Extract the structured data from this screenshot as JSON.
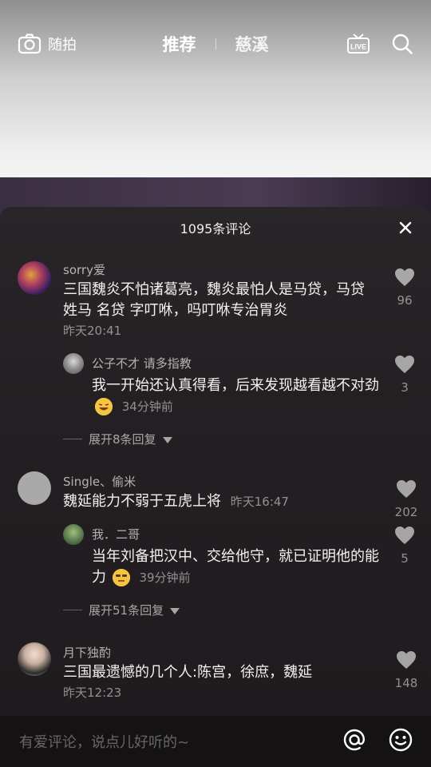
{
  "top_bar": {
    "camera_label": "随拍",
    "tabs": [
      {
        "label": "推荐",
        "active": true
      },
      {
        "label": "慈溪",
        "active": false
      }
    ]
  },
  "sheet": {
    "title": "1095条评论"
  },
  "comments": [
    {
      "user": "sorry爱",
      "text": "三国魏炎不怕诸葛亮，魏炎最怕人是马贷，马贷 姓马 名贷 字叮咻，吗叮咻专治胃炎",
      "time": "昨天20:41",
      "likes": "96"
    },
    {
      "user": "公子不才 请多指教",
      "text": "我一开始还认真得看，后来发现越看越不对劲",
      "time": "34分钟前",
      "likes": "3",
      "reply": true
    },
    {
      "user": "Single、偷米",
      "text": "魏延能力不弱于五虎上将",
      "time": "昨天16:47",
      "likes": "202"
    },
    {
      "user": "我．二哥",
      "text": "当年刘备把汉中、交给他守，就已证明他的能力",
      "time": "39分钟前",
      "likes": "5",
      "reply": true
    },
    {
      "user": "月下独酌",
      "text": "三国最遗憾的几个人:陈宫，徐庶，魏延",
      "time": "昨天12:23",
      "likes": "148"
    }
  ],
  "expand_replies": [
    {
      "label": "展开8条回复"
    },
    {
      "label": "展开51条回复"
    }
  ],
  "input": {
    "placeholder": "有爱评论，说点儿好听的~"
  },
  "colors": {
    "sheet_bg": "#231f22",
    "text_primary": "#f2f2f2",
    "text_secondary": "#8c8a8b"
  }
}
